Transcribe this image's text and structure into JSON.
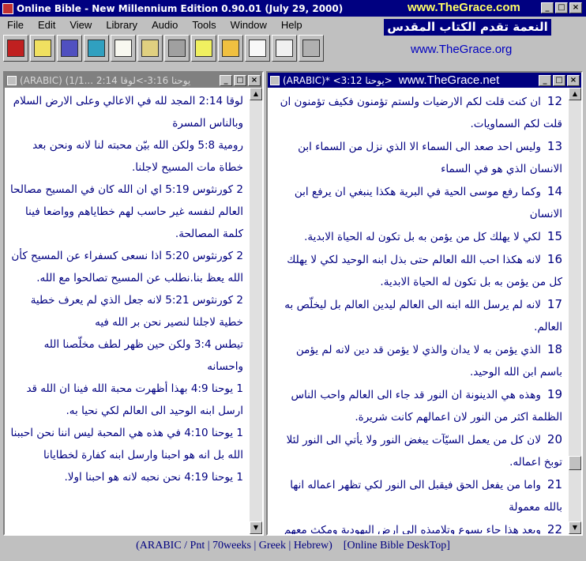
{
  "window": {
    "title": "Online Bible - New Millennium Edition 0.90.01 (July 29, 2000)",
    "brand": "www.TheGrace.com"
  },
  "menu": [
    "File",
    "Edit",
    "View",
    "Library",
    "Audio",
    "Tools",
    "Window",
    "Help"
  ],
  "branding": {
    "arabic": "النعمة تقدم الكتاب المقدس",
    "url": "www.TheGrace.org"
  },
  "toolbar": [
    {
      "name": "bible-book-icon",
      "color": "#c02020"
    },
    {
      "name": "notes-icon",
      "color": "#f0e060"
    },
    {
      "name": "library-books-icon",
      "color": "#5050c0"
    },
    {
      "name": "globe-icon",
      "color": "#30a0c0"
    },
    {
      "name": "open-book-icon",
      "color": "#f8f8f0"
    },
    {
      "name": "pen-writing-icon",
      "color": "#e0d080"
    },
    {
      "name": "search-lens-icon",
      "color": "#a0a0a0"
    },
    {
      "name": "clipboard-icon",
      "color": "#f0f060"
    },
    {
      "name": "chart-folder-icon",
      "color": "#f0c040"
    },
    {
      "name": "quill-pen-icon",
      "color": "#f8f8f8"
    },
    {
      "name": "document-scroll-icon",
      "color": "#f0f0f0"
    },
    {
      "name": "printer-icon",
      "color": "#b0b0b0"
    }
  ],
  "left_pane": {
    "title": "(ARABIC) (1/1... يوحنا 3:16->لوقا 2:14",
    "verses": [
      {
        "ref": "لوقا 2:14",
        "text": "المجد لله في الاعالي وعلى الارض السلام وبالناس المسرة"
      },
      {
        "ref": "رومية 5:8",
        "text": "ولكن الله بيّن محبته لنا لانه ونحن بعد خطاة مات المسيح لاجلنا."
      },
      {
        "ref": "2 كورنثوس 5:19",
        "text": "اي ان الله كان في المسيح مصالحا العالم لنفسه غير حاسب لهم خطاياهم وواضعا فينا كلمة المصالحة."
      },
      {
        "ref": "2 كورنثوس 5:20",
        "text": "اذا نسعى كسفراء عن المسيح كأن الله يعظ بنا.نطلب عن المسيح تصالحوا مع الله."
      },
      {
        "ref": "2 كورنثوس 5:21",
        "text": "لانه جعل الذي لم يعرف خطية خطية لاجلنا لنصير نحن بر الله فيه"
      },
      {
        "ref": "تيطس 3:4",
        "text": "ولكن حين ظهر لطف مخلّصنا الله واحسانه"
      },
      {
        "ref": "1 يوحنا 4:9",
        "text": "بهذا أظهرت محبة الله فينا ان الله قد ارسل ابنه الوحيد الى العالم لكي نحيا به."
      },
      {
        "ref": "1 يوحنا 4:10",
        "text": "في هذه هي المحبة ليس اننا نحن احببنا الله بل انه هو احبنا وارسل ابنه كفارة لخطايانا"
      },
      {
        "ref": "1 يوحنا 4:19",
        "text": "نحن نحبه لانه هو احبنا اولا."
      }
    ]
  },
  "right_pane": {
    "title": "(ARABIC)* <يوحنا 3:12>",
    "brand": "www.TheGrace.net",
    "verses": [
      {
        "num": "12",
        "text": "ان كنت قلت لكم الارضيات ولستم تؤمنون فكيف تؤمنون ان قلت لكم السماويات."
      },
      {
        "num": "13",
        "text": "وليس احد صعد الى السماء الا الذي نزل من السماء ابن الانسان الذي هو في السماء"
      },
      {
        "num": "14",
        "text": "وكما رفع موسى الحية في البرية هكذا ينبغي ان يرفع ابن الانسان"
      },
      {
        "num": "15",
        "text": "لكي لا يهلك كل من يؤمن به بل تكون له الحياة الابدية."
      },
      {
        "num": "16",
        "text": "لانه هكذا احب الله العالم حتى بذل ابنه الوحيد لكي لا يهلك كل من يؤمن به بل تكون له الحياة الابدية."
      },
      {
        "num": "17",
        "text": "لانه لم يرسل الله ابنه الى العالم ليدين العالم بل ليخلّص به العالم."
      },
      {
        "num": "18",
        "text": "الذي يؤمن به لا يدان والذي لا يؤمن قد دين لانه لم يؤمن باسم ابن الله الوحيد."
      },
      {
        "num": "19",
        "text": "وهذه هي الدينونة ان النور قد جاء الى العالم واحب الناس الظلمة اكثر من النور لان اعمالهم كانت شريرة."
      },
      {
        "num": "20",
        "text": "لان كل من يعمل السيّآت يبغض النور ولا يأتي الى النور لئلا توبخ اعماله."
      },
      {
        "num": "21",
        "text": "واما من يفعل الحق فيقبل الى النور لكي تظهر اعماله انها بالله معمولة"
      },
      {
        "num": "22",
        "text": "وبعد هذا جاء يسوع وتلاميذه الى ارض اليهودية ومكث معهم"
      }
    ]
  },
  "status": {
    "modules": "(ARABIC / Pnt | 70weeks | Greek | Hebrew)",
    "desktop": "[Online Bible DeskTop]"
  }
}
